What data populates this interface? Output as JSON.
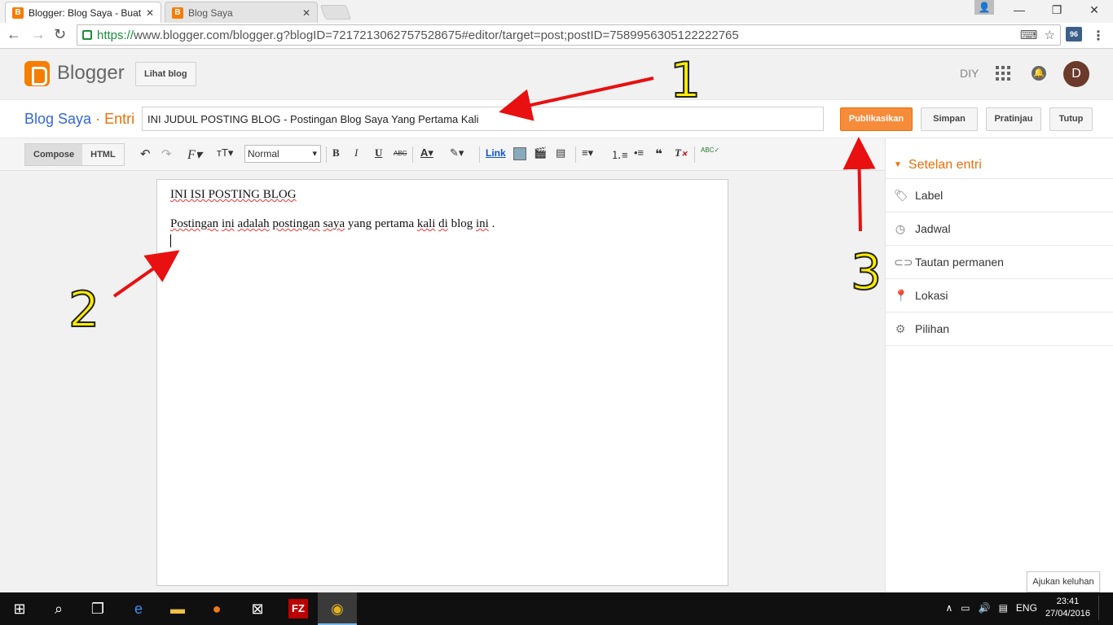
{
  "browser": {
    "tabs": [
      {
        "label": "Blogger: Blog Saya - Buat",
        "active": true
      },
      {
        "label": "Blog Saya",
        "active": false
      }
    ],
    "url_scheme": "https://",
    "url_rest": "www.blogger.com/blogger.g?blogID=7217213062757528675#editor/target=post;postID=7589956305122222765",
    "extension_badge": "96"
  },
  "header": {
    "brand": "Blogger",
    "view_blog_label": "Lihat blog",
    "diy_label": "DIY",
    "avatar_letter": "D"
  },
  "titlebar": {
    "blog_name": "Blog Saya",
    "separator": "·",
    "section": "Entri",
    "post_title_value": "INI JUDUL POSTING BLOG - Postingan Blog Saya Yang Pertama Kali",
    "publish_label": "Publikasikan",
    "save_label": "Simpan",
    "preview_label": "Pratinjau",
    "close_label": "Tutup"
  },
  "editor_toolbar": {
    "compose_label": "Compose",
    "html_label": "HTML",
    "format_value": "Normal",
    "link_label": "Link"
  },
  "editor": {
    "line1": "INI ISI POSTING BLOG",
    "line2_words": [
      "Postingan",
      "ini",
      "adalah",
      "postingan",
      "saya",
      "yang",
      "pertama",
      "kali",
      "di",
      "blog",
      "ini",
      "."
    ]
  },
  "sidebar": {
    "heading": "Setelan entri",
    "items": [
      {
        "label": "Label",
        "icon": "tag-icon"
      },
      {
        "label": "Jadwal",
        "icon": "clock-icon"
      },
      {
        "label": "Tautan permanen",
        "icon": "link-icon"
      },
      {
        "label": "Lokasi",
        "icon": "location-pin-icon"
      },
      {
        "label": "Pilihan",
        "icon": "gear-icon"
      }
    ]
  },
  "feedback_label": "Ajukan keluhan",
  "annotations": [
    "1",
    "2",
    "3"
  ],
  "taskbar": {
    "language": "ENG",
    "time": "23:41",
    "date": "27/04/2016"
  },
  "colors": {
    "accent_orange": "#f68b3a",
    "brand_orange": "#f57d00",
    "link_blue": "#3367d6",
    "annotation_yellow": "#ffee00",
    "arrow_red": "#e81010"
  }
}
